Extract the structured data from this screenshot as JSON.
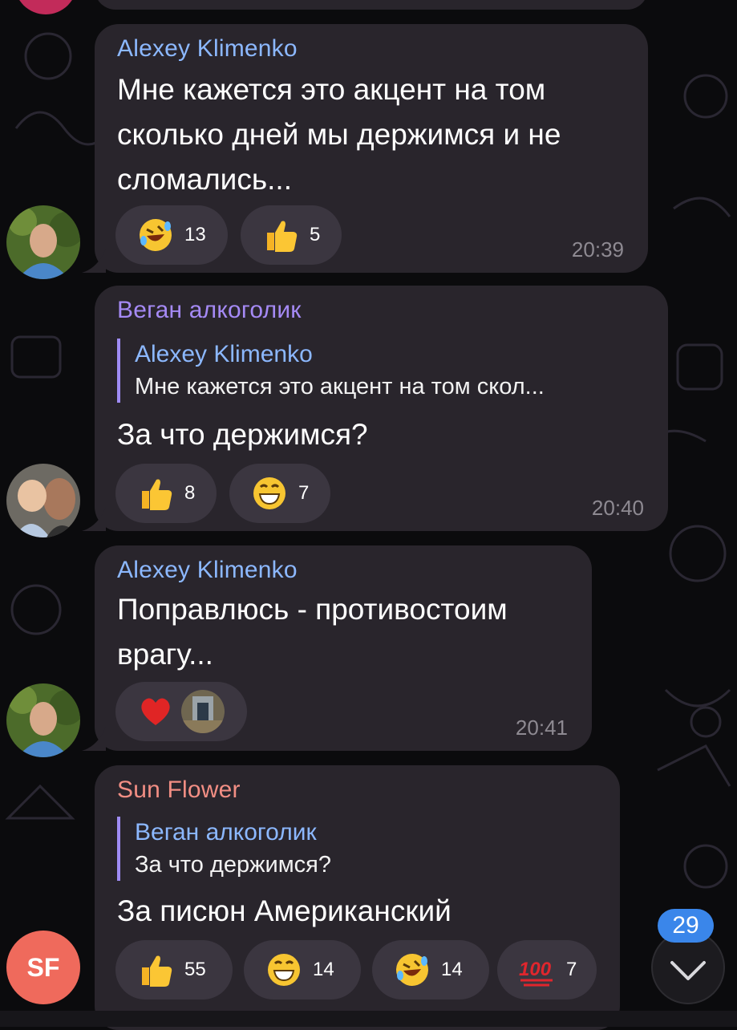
{
  "colors": {
    "bubble": "#29252c",
    "reaction_bg": "#3b3640",
    "sender_blue": "#8cb8ff",
    "sender_purple": "#a58af5",
    "sender_pink": "#f28e84",
    "reply_bar": "#9f8cf5",
    "time": "#8e8a92",
    "badge": "#3a86ea"
  },
  "messages": [
    {
      "sender": "Alexey Klimenko",
      "text": "Мне кажется это акцент на том\nсколько дней мы держимся и не\nсломались...",
      "reactions": [
        {
          "emoji": "rofl-emoji-icon",
          "count": "13"
        },
        {
          "emoji": "thumbs-up-icon",
          "count": "5"
        }
      ],
      "time": "20:39"
    },
    {
      "sender": "Веган алкоголик",
      "reply": {
        "name": "Alexey Klimenko",
        "text": "Мне кажется это акцент на том скол..."
      },
      "text": "За что держимся?",
      "reactions": [
        {
          "emoji": "thumbs-up-icon",
          "count": "8"
        },
        {
          "emoji": "grin-emoji-icon",
          "count": "7"
        }
      ],
      "time": "20:40"
    },
    {
      "sender": "Alexey Klimenko",
      "text": "Поправлюсь - противостоим\nврагу...",
      "reactions": [
        {
          "emoji": "heart-icon",
          "count": ""
        }
      ],
      "time": "20:41"
    },
    {
      "sender": "Sun Flower",
      "reply": {
        "name": "Веган алкоголик",
        "text": "За что держимся?"
      },
      "text": "За писюн Американский",
      "reactions": [
        {
          "emoji": "thumbs-up-icon",
          "count": "55"
        },
        {
          "emoji": "grin-emoji-icon",
          "count": "14"
        },
        {
          "emoji": "rofl-emoji-icon",
          "count": "14"
        },
        {
          "emoji": "hundred-icon",
          "count": "7"
        }
      ],
      "time": ""
    }
  ],
  "avatar_initials": "SF",
  "unread_badge": "29"
}
